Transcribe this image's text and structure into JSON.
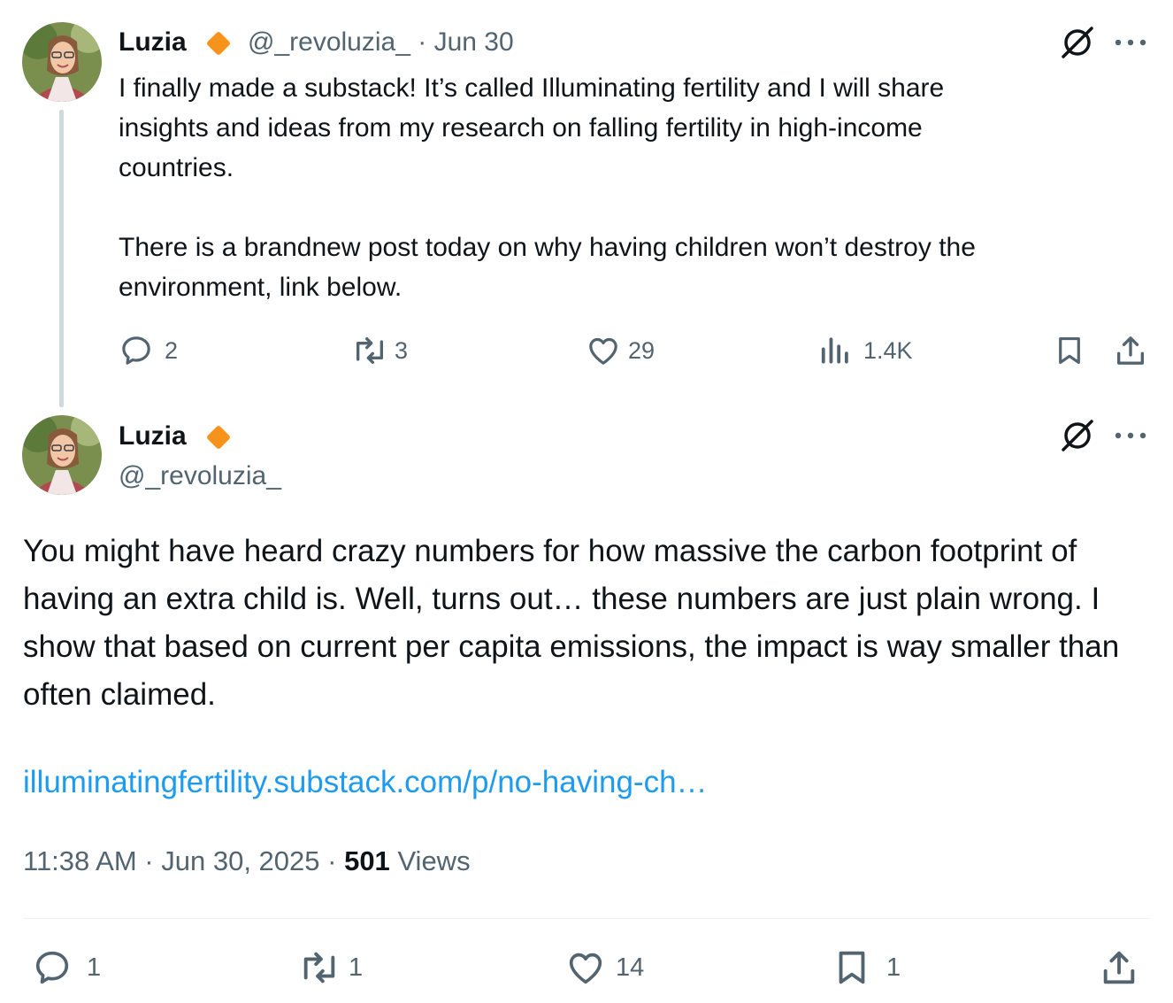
{
  "parent_tweet": {
    "author_name": "Luzia",
    "handle": "@_revoluzia_",
    "separator": " · ",
    "date": "Jun 30",
    "text_lines": [
      "I finally made a substack! It’s called Illuminating fertility and I will share",
      "insights and ideas from my research on falling fertility in high-income",
      "countries.",
      "",
      "There is a brandnew post today on why having children won’t destroy the",
      "environment, link below."
    ],
    "stats": {
      "replies": "2",
      "reposts": "3",
      "likes": "29",
      "views": "1.4K"
    }
  },
  "main_tweet": {
    "author_name": "Luzia",
    "handle": "@_revoluzia_",
    "text": "You might have heard crazy numbers for how massive the carbon footprint of having an extra child is. Well, turns out… these numbers are just plain wrong. I show that based on current per capita emissions, the impact is way smaller than often claimed.",
    "link": "illuminatingfertility.substack.com/p/no-having-ch…",
    "time": "11:38 AM",
    "date": "Jun 30, 2025",
    "meta_sep": " · ",
    "views_count": "501",
    "views_label": "Views",
    "stats": {
      "replies": "1",
      "reposts": "1",
      "likes": "14",
      "bookmarks": "1"
    }
  },
  "icons": {
    "badge": "orange-diamond-badge-icon",
    "grok": "grok-slash-icon",
    "more": "more-dots-icon",
    "reply": "reply-icon",
    "repost": "repost-icon",
    "like": "heart-icon",
    "views": "views-chart-icon",
    "bookmark": "bookmark-icon",
    "share": "share-icon"
  },
  "colors": {
    "text": "#0f1419",
    "secondary": "#536471",
    "link": "#1d9bf0",
    "badge": "#f7931a",
    "thread_line": "#cfd9de"
  }
}
